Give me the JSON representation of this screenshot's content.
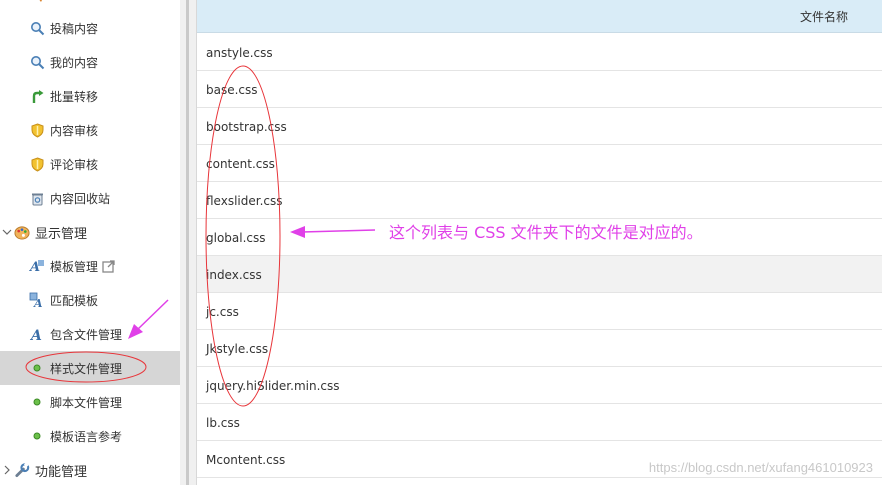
{
  "sidebar": {
    "items": [
      {
        "label": "投稿内容",
        "icon": "search-icon"
      },
      {
        "label": "我的内容",
        "icon": "search-icon"
      },
      {
        "label": "批量转移",
        "icon": "turn-arrow-icon"
      },
      {
        "label": "内容审核",
        "icon": "shield-icon"
      },
      {
        "label": "评论审核",
        "icon": "shield-icon"
      },
      {
        "label": "内容回收站",
        "icon": "recycle-icon"
      },
      {
        "label": "显示管理",
        "icon": "palette-icon"
      },
      {
        "label": "模板管理",
        "icon": "template-icon"
      },
      {
        "label": "匹配模板",
        "icon": "match-template-icon"
      },
      {
        "label": "包含文件管理",
        "icon": "letter-a-icon"
      },
      {
        "label": "样式文件管理",
        "icon": "dot-icon"
      },
      {
        "label": "脚本文件管理",
        "icon": "dot-icon"
      },
      {
        "label": "模板语言参考",
        "icon": "dot-icon"
      },
      {
        "label": "功能管理",
        "icon": "wrench-icon"
      }
    ]
  },
  "table": {
    "header_name": "文件名称",
    "rows": [
      "anstyle.css",
      "base.css",
      "bootstrap.css",
      "content.css",
      "flexslider.css",
      "global.css",
      "index.css",
      "jc.css",
      "Jkstyle.css",
      "jquery.hiSlider.min.css",
      "lb.css",
      "Mcontent.css"
    ]
  },
  "annotation": {
    "note": "这个列表与 CSS 文件夹下的文件是对应的。",
    "color": "#e040e8"
  },
  "watermark": "https://blog.csdn.net/xufang461010923",
  "colors": {
    "header_bg": "#d9ecf7",
    "active_bg": "#d6d6d6",
    "alt_row_bg": "#f2f2f2"
  }
}
